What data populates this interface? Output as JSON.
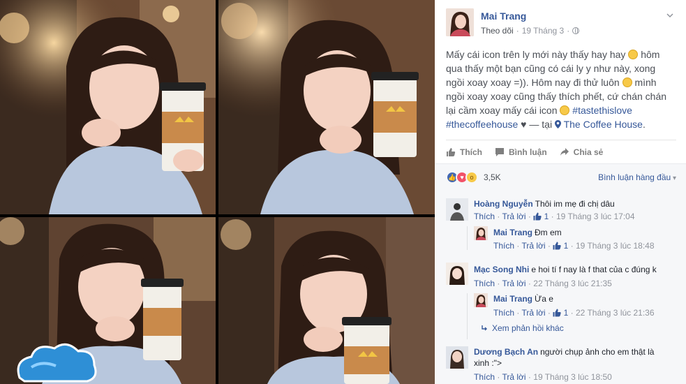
{
  "post": {
    "author": "Mai Trang",
    "follow": "Theo dõi",
    "date": "19 Tháng 3",
    "dot": "·",
    "text_1": "Mấy cái icon trên ly mới này thấy hay hay",
    "text_2": "hôm qua thấy một bạn cũng có cái ly y như này, xong ngồi xoay xoay =)). Hôm nay đi thử luôn",
    "text_3": "mình ngồi xoay xoay cũng thấy thích phết, cứ chán chán lại cầm xoay mấy cái icon",
    "hashtag_1": "#tastethislove",
    "hashtag_2": "#thecoffeehouse",
    "heart": "♥",
    "dash_at": "— tại",
    "place": "The Coffee House",
    "period": "."
  },
  "actions": {
    "like": "Thích",
    "comment": "Bình luận",
    "share": "Chia sẻ"
  },
  "reactions": {
    "count": "3,5K",
    "sort_label": "Bình luận hàng đầu"
  },
  "comments": [
    {
      "name": "Hoàng Nguyễn",
      "text": "Thôi im mẹ đi chị dâu",
      "like": "Thích",
      "reply": "Trả lời",
      "likes": "1",
      "time": "19 Tháng 3 lúc 17:04"
    },
    {
      "name": "Mai Trang",
      "text": "Đm em",
      "like": "Thích",
      "reply": "Trả lời",
      "likes": "1",
      "time": "19 Tháng 3 lúc 18:48"
    },
    {
      "name": "Mạc Song Nhi",
      "text": "e hoi tí f nay là f that của c đúng k",
      "like": "Thích",
      "reply": "Trả lời",
      "time": "22 Tháng 3 lúc 21:35"
    },
    {
      "name": "Mai Trang",
      "text": "Ừa e",
      "like": "Thích",
      "reply": "Trả lời",
      "likes": "1",
      "time": "22 Tháng 3 lúc 21:36"
    },
    {
      "name": "Dương Bạch An",
      "text": "người chụp ảnh cho em thật là xinh :\">",
      "like": "Thích",
      "reply": "Trả lời",
      "time": "19 Tháng 3 lúc 18:50"
    }
  ],
  "more_replies": "Xem phản hồi khác",
  "sep": "·"
}
